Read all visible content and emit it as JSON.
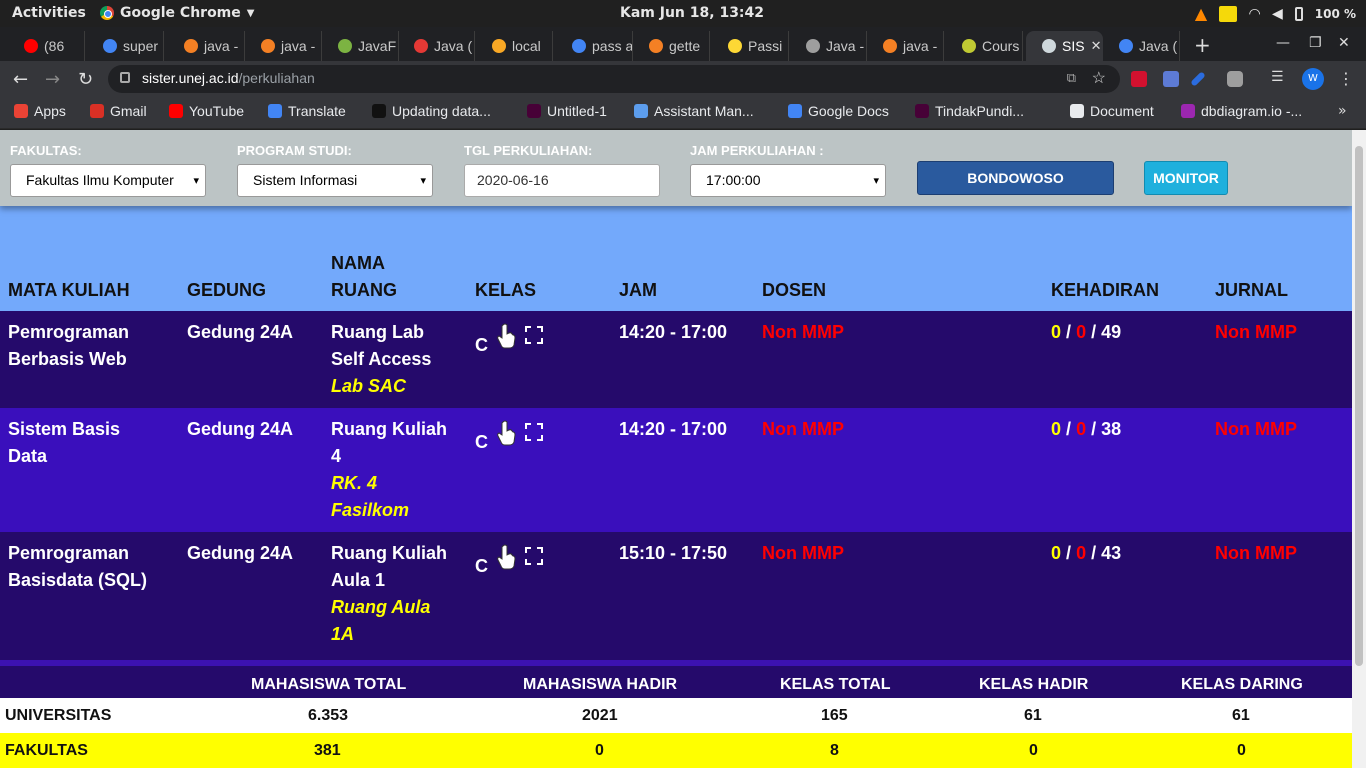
{
  "system_bar": {
    "activities": "Activities",
    "app_name": "Google Chrome",
    "clock": "Kam Jun 18, 13:42",
    "battery": "100 %"
  },
  "tabs": [
    {
      "label": "(86",
      "color": "#ff0000"
    },
    {
      "label": "super",
      "color": "#4285f4"
    },
    {
      "label": "java -",
      "color": "#f48024"
    },
    {
      "label": "java -",
      "color": "#f48024"
    },
    {
      "label": "JavaF",
      "color": "#7cb342"
    },
    {
      "label": "Java (",
      "color": "#e53935"
    },
    {
      "label": "local",
      "color": "#f9a825"
    },
    {
      "label": "pass a",
      "color": "#4285f4"
    },
    {
      "label": "gette",
      "color": "#f48024"
    },
    {
      "label": "Passi",
      "color": "#fdd835"
    },
    {
      "label": "Java -",
      "color": "#9e9e9e"
    },
    {
      "label": "java -",
      "color": "#f48024"
    },
    {
      "label": "Cours",
      "color": "#c0ca33"
    },
    {
      "label": "SIS",
      "color": "#cfd8dc"
    },
    {
      "label": "Java (",
      "color": "#4285f4"
    }
  ],
  "address": {
    "host": "sister.unej.ac.id",
    "path": "/perkuliahan",
    "profile_initial": "W"
  },
  "bookmarks": [
    {
      "label": "Apps",
      "color": "#ea4335"
    },
    {
      "label": "Gmail",
      "color": "#d93025"
    },
    {
      "label": "YouTube",
      "color": "#ff0000"
    },
    {
      "label": "Translate",
      "color": "#4285f4"
    },
    {
      "label": "Updating data...",
      "color": "#111111"
    },
    {
      "label": "Untitled-1",
      "color": "#470137"
    },
    {
      "label": "Assistant Man...",
      "color": "#5c9ded"
    },
    {
      "label": "Google Docs",
      "color": "#4285f4"
    },
    {
      "label": "TindakPundi...",
      "color": "#470137"
    },
    {
      "label": "Document",
      "color": "#e8eaed"
    },
    {
      "label": "dbdiagram.io -...",
      "color": "#9c27b0"
    }
  ],
  "filters": {
    "fakultas_label": "FAKULTAS:",
    "fakultas_value": "Fakultas Ilmu Komputer",
    "prodi_label": "PROGRAM STUDI:",
    "prodi_value": "Sistem Informasi",
    "tgl_label": "TGL PERKULIAHAN:",
    "tgl_value": "2020-06-16",
    "jam_label": "JAM PERKULIAHAN :",
    "jam_value": "17:00:00",
    "bondowoso_button": "BONDOWOSO",
    "monitor_button": "MONITOR"
  },
  "table": {
    "headers": {
      "mata_kuliah": "MATA KULIAH",
      "gedung": "GEDUNG",
      "nama_ruang_1": "NAMA",
      "nama_ruang_2": "RUANG",
      "kelas": "KELAS",
      "jam": "JAM",
      "dosen": "DOSEN",
      "kehadiran": "KEHADIRAN",
      "jurnal": "JURNAL"
    },
    "rows": [
      {
        "mk1": "Pemrograman",
        "mk2": "Berbasis Web",
        "gedung": "Gedung 24A",
        "ruang1": "Ruang Lab",
        "ruang2": "Self Access",
        "kode1": "Lab SAC",
        "kode2": "",
        "kelas": "C",
        "jam": "14:20 - 17:00",
        "dosen": "Non MMP",
        "hadir_a": "0",
        "hadir_b": "0",
        "hadir_total": "49",
        "sep": "/",
        "jurnal": "Non MMP",
        "bg": "#250a6b"
      },
      {
        "mk1": "Sistem Basis",
        "mk2": "Data",
        "gedung": "Gedung 24A",
        "ruang1": "Ruang Kuliah",
        "ruang2": "4",
        "kode1": "RK. 4",
        "kode2": "Fasilkom",
        "kelas": "C",
        "jam": "14:20 - 17:00",
        "dosen": "Non MMP",
        "hadir_a": "0",
        "hadir_b": "0",
        "hadir_total": "38",
        "sep": "/",
        "jurnal": "Non MMP",
        "bg": "#3a0fbc"
      },
      {
        "mk1": "Pemrograman",
        "mk2": "Basisdata (SQL)",
        "gedung": "Gedung 24A",
        "ruang1": "Ruang Kuliah",
        "ruang2": "Aula 1",
        "kode1": "Ruang Aula",
        "kode2": "1A",
        "kelas": "C",
        "jam": "15:10 - 17:50",
        "dosen": "Non MMP",
        "hadir_a": "0",
        "hadir_b": "0",
        "hadir_total": "43",
        "sep": "/",
        "jurnal": "Non MMP",
        "bg": "#250a6b"
      }
    ]
  },
  "summary": {
    "headers": [
      "MAHASISWA TOTAL",
      "MAHASISWA HADIR",
      "KELAS TOTAL",
      "KELAS HADIR",
      "KELAS DARING"
    ],
    "universitas": {
      "label": "UNIVERSITAS",
      "values": [
        "6.353",
        "2021",
        "165",
        "61",
        "61"
      ]
    },
    "fakultas": {
      "label": "FAKULTAS",
      "values": [
        "381",
        "0",
        "8",
        "0",
        "0"
      ]
    }
  }
}
